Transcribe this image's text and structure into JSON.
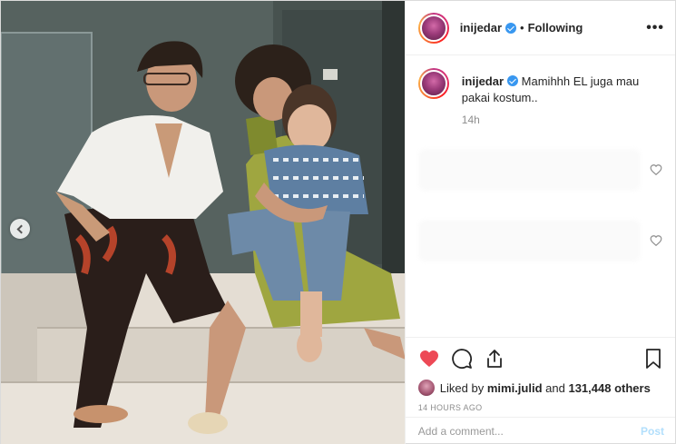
{
  "post": {
    "username": "inijedar",
    "follow_status": "Following",
    "separator": "•",
    "more_icon": "more-horizontal-icon",
    "caption": "Mamihhh EL juga mau pakai kostum..",
    "caption_time": "14h",
    "liked_by_prefix": "Liked by",
    "liked_by_user": "mimi.julid",
    "liked_and": "and",
    "likes_others": "131,448 others",
    "timestamp": "14 HOURS AGO",
    "comment_placeholder": "Add a comment...",
    "post_label": "Post"
  },
  "colors": {
    "like_red": "#ed4956",
    "verified_blue": "#3897f0",
    "post_disabled": "#b2dffc"
  },
  "icons": [
    "heart-filled-icon",
    "comment-icon",
    "share-icon",
    "bookmark-icon",
    "verified-badge-icon",
    "chevron-left-icon"
  ]
}
